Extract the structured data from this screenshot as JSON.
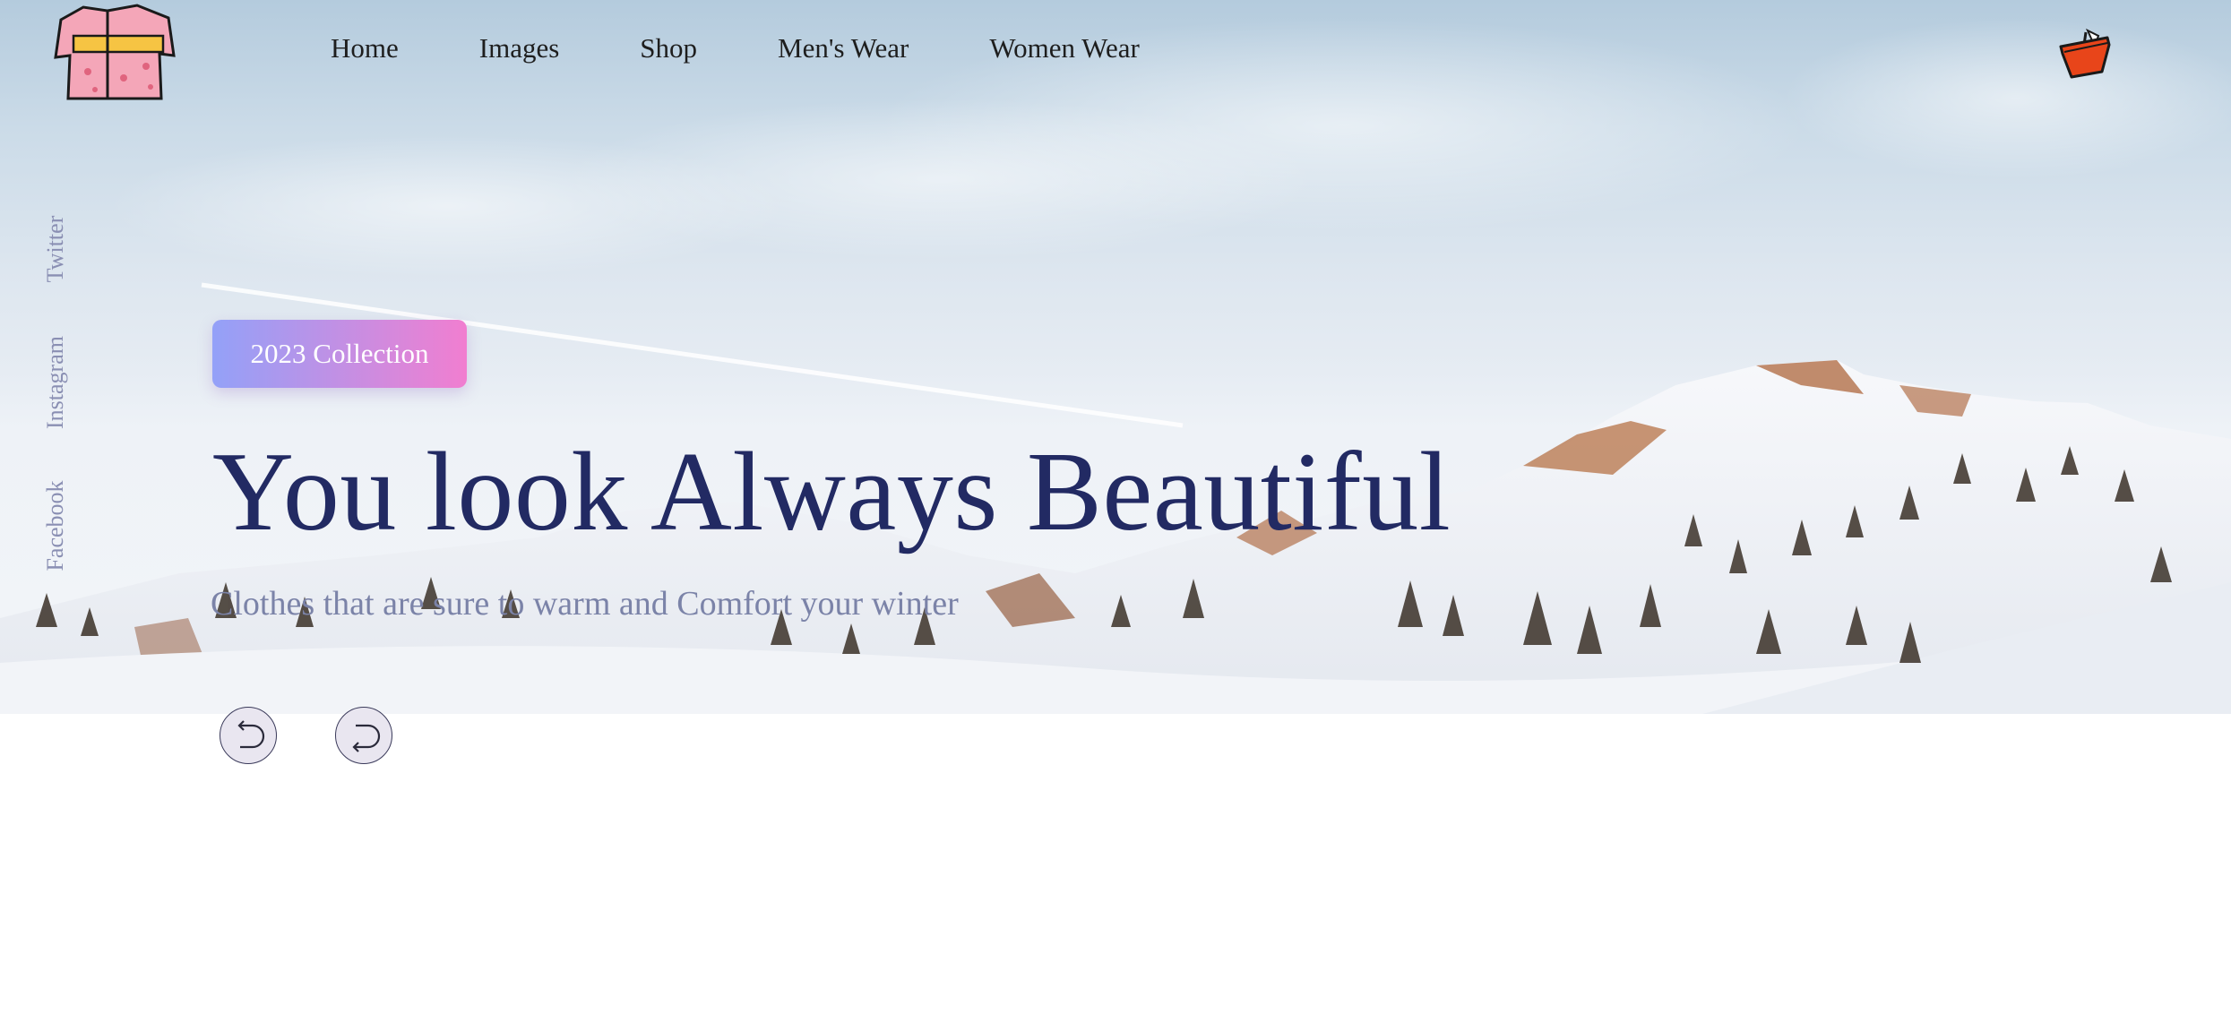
{
  "nav": {
    "items": [
      {
        "label": "Home"
      },
      {
        "label": "Images"
      },
      {
        "label": "Shop"
      },
      {
        "label": "Men's Wear"
      },
      {
        "label": "Women Wear"
      }
    ]
  },
  "social": {
    "twitter": "Twitter",
    "instagram": "Instagram",
    "facebook": "Facebook"
  },
  "hero": {
    "badge": "2023 Collection",
    "headline": "You look Always Beautiful",
    "subtitle": "Clothes that are sure to warm and Comfort your winter"
  },
  "icons": {
    "logo": "kimono-icon",
    "cart": "shopping-basket-icon",
    "prev": "rotate-left-arrow-icon",
    "next": "rotate-right-arrow-icon"
  },
  "colors": {
    "headline": "#222a63",
    "subtitle": "#7b83a8",
    "badge_gradient_start": "#93a1f8",
    "badge_gradient_end": "#f17ed0",
    "cart": "#e8451a",
    "logo": "#f4a6b8"
  }
}
